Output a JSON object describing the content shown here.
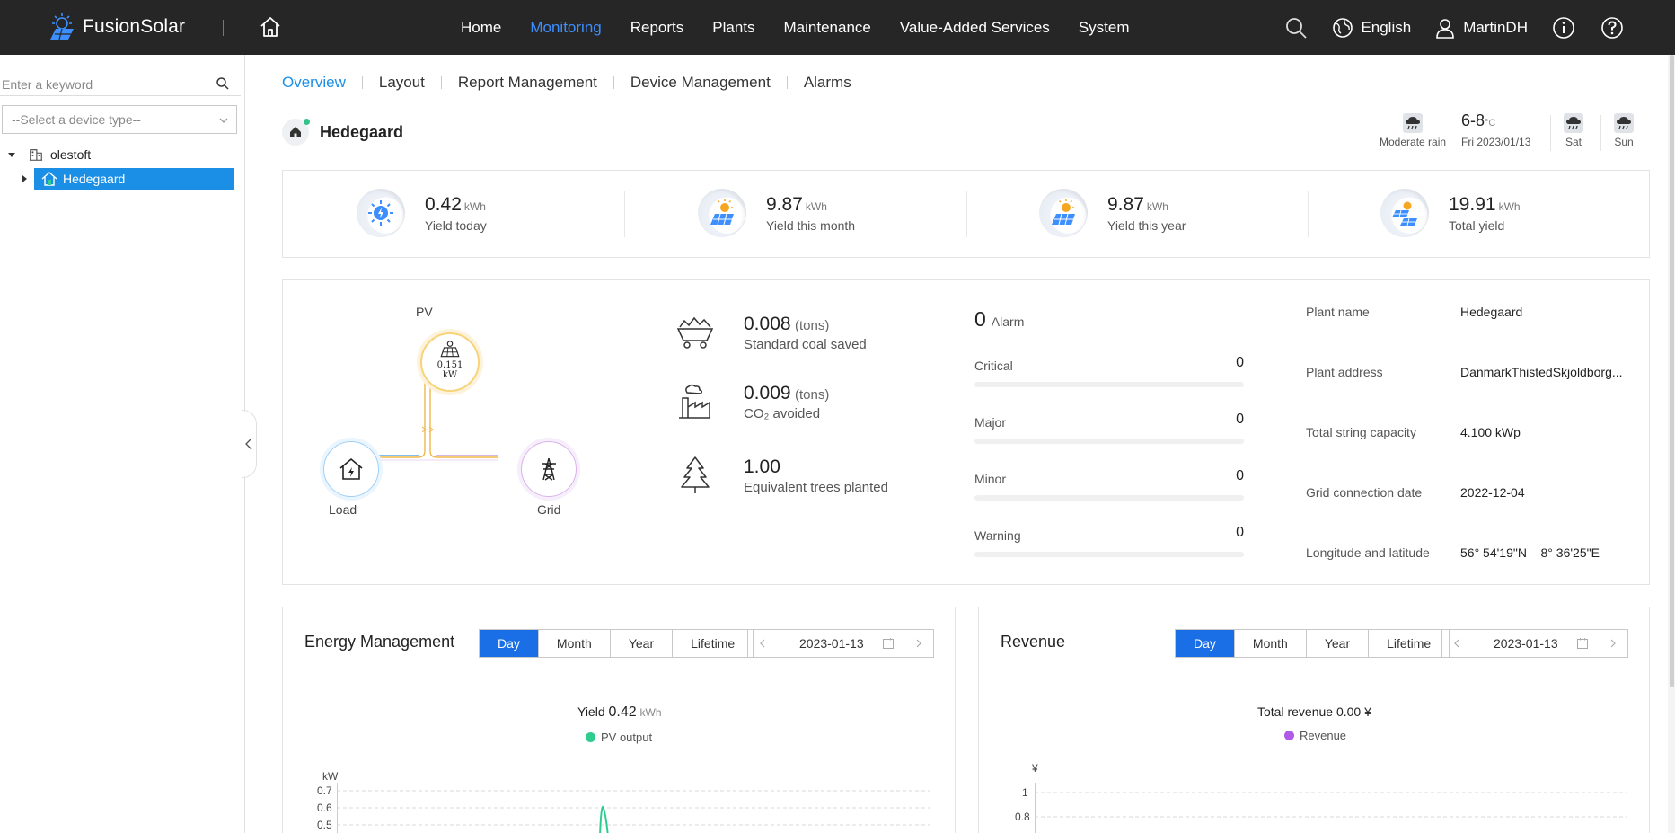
{
  "app": {
    "brand": "FusionSolar"
  },
  "nav": {
    "items": [
      {
        "label": "Home",
        "active": false
      },
      {
        "label": "Monitoring",
        "active": true
      },
      {
        "label": "Reports",
        "active": false
      },
      {
        "label": "Plants",
        "active": false
      },
      {
        "label": "Maintenance",
        "active": false
      },
      {
        "label": "Value-Added Services",
        "active": false
      },
      {
        "label": "System",
        "active": false
      }
    ]
  },
  "topright": {
    "language": "English",
    "user": "MartinDH"
  },
  "sidebar": {
    "search_placeholder": "Enter a keyword",
    "device_type_placeholder": "--Select a device type--",
    "tree": {
      "root": "olestoft",
      "child": "Hedegaard"
    }
  },
  "subnav": [
    "Overview",
    "Layout",
    "Report Management",
    "Device Management",
    "Alarms"
  ],
  "plant": {
    "name": "Hedegaard"
  },
  "weather": {
    "today_desc": "Moderate rain",
    "temp": "6-8",
    "temp_unit": "°C",
    "date": "Fri  2023/01/13",
    "day2": "Sat",
    "day3": "Sun"
  },
  "yields": [
    {
      "value": "0.42",
      "unit": "kWh",
      "label": "Yield today"
    },
    {
      "value": "9.87",
      "unit": "kWh",
      "label": "Yield this month"
    },
    {
      "value": "9.87",
      "unit": "kWh",
      "label": "Yield this year"
    },
    {
      "value": "19.91",
      "unit": "kWh",
      "label": "Total yield"
    }
  ],
  "flow": {
    "pv_label": "PV",
    "pv_value": "0.151",
    "pv_unit": "kW",
    "load_label": "Load",
    "grid_label": "Grid"
  },
  "environment": [
    {
      "value": "0.008",
      "unit": "(tons)",
      "label": "Standard coal saved"
    },
    {
      "value": "0.009",
      "unit": "(tons)",
      "label": "CO₂ avoided"
    },
    {
      "value": "1.00",
      "unit": "",
      "label": "Equivalent trees planted"
    }
  ],
  "alarms": {
    "total": "0",
    "word": "Alarm",
    "rows": [
      {
        "label": "Critical",
        "count": "0"
      },
      {
        "label": "Major",
        "count": "0"
      },
      {
        "label": "Minor",
        "count": "0"
      },
      {
        "label": "Warning",
        "count": "0"
      }
    ]
  },
  "plant_info": [
    {
      "label": "Plant name",
      "value": "Hedegaard"
    },
    {
      "label": "Plant address",
      "value": "DanmarkThistedSkjoldborg..."
    },
    {
      "label": "Total string capacity",
      "value": "4.100 kWp"
    },
    {
      "label": "Grid connection date",
      "value": "2022-12-04"
    },
    {
      "label": "Longitude and latitude",
      "value": "56° 54'19\"N    8° 36'25\"E"
    }
  ],
  "energy_panel": {
    "title": "Energy Management",
    "tabs": [
      {
        "label": "Day",
        "active": true
      },
      {
        "label": "Month",
        "active": false
      },
      {
        "label": "Year",
        "active": false
      },
      {
        "label": "Lifetime",
        "active": false
      }
    ],
    "date": "2023-01-13",
    "summary_label": "Yield",
    "summary_value": "0.42",
    "summary_unit": "kWh",
    "legend": "PV output",
    "legend_color": "#2ecc8f",
    "y_unit": "kW"
  },
  "revenue_panel": {
    "title": "Revenue",
    "tabs": [
      {
        "label": "Day",
        "active": true
      },
      {
        "label": "Month",
        "active": false
      },
      {
        "label": "Year",
        "active": false
      },
      {
        "label": "Lifetime",
        "active": false
      }
    ],
    "date": "2023-01-13",
    "summary": "Total revenue 0.00 ¥",
    "legend": "Revenue",
    "legend_color": "#b05be8",
    "y_unit": "¥"
  },
  "chart_data": [
    {
      "type": "line",
      "title": "",
      "ylabel": "kW",
      "yticks": [
        "0.7",
        "0.6",
        "0.5"
      ],
      "ylim": [
        0.5,
        0.7
      ],
      "series": [
        {
          "name": "PV output",
          "color": "#2ecc8f",
          "values": [
            0.5,
            0.62,
            0.5
          ]
        }
      ]
    },
    {
      "type": "line",
      "title": "",
      "ylabel": "¥",
      "yticks": [
        "1",
        "0.8"
      ],
      "ylim": [
        0.8,
        1
      ],
      "series": [
        {
          "name": "Revenue",
          "color": "#b05be8",
          "values": []
        }
      ]
    }
  ]
}
